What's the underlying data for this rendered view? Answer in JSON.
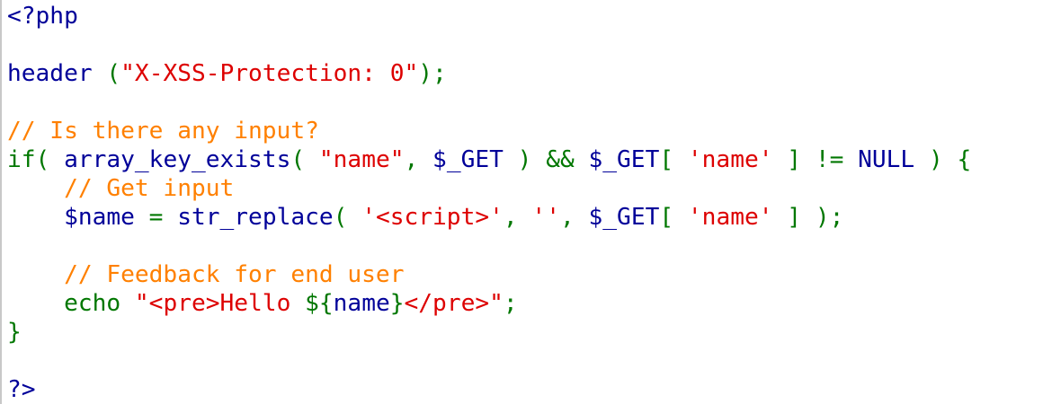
{
  "lines": [
    [
      {
        "text": "<?php",
        "c": "c-blue"
      }
    ],
    [],
    [
      {
        "text": "header ",
        "c": "c-blue"
      },
      {
        "text": "(",
        "c": "c-green"
      },
      {
        "text": "\"X-XSS-Protection: 0\"",
        "c": "c-red"
      },
      {
        "text": ");",
        "c": "c-green"
      }
    ],
    [],
    [
      {
        "text": "// Is there any input?",
        "c": "c-orange"
      }
    ],
    [
      {
        "text": "if( ",
        "c": "c-green"
      },
      {
        "text": "array_key_exists",
        "c": "c-blue"
      },
      {
        "text": "( ",
        "c": "c-green"
      },
      {
        "text": "\"name\"",
        "c": "c-red"
      },
      {
        "text": ", ",
        "c": "c-green"
      },
      {
        "text": "$_GET ",
        "c": "c-blue"
      },
      {
        "text": ") && ",
        "c": "c-green"
      },
      {
        "text": "$_GET",
        "c": "c-blue"
      },
      {
        "text": "[ ",
        "c": "c-green"
      },
      {
        "text": "'name' ",
        "c": "c-red"
      },
      {
        "text": "] != ",
        "c": "c-green"
      },
      {
        "text": "NULL ",
        "c": "c-blue"
      },
      {
        "text": ") {",
        "c": "c-green"
      }
    ],
    [
      {
        "text": "    // Get input",
        "c": "c-orange"
      }
    ],
    [
      {
        "text": "    $name ",
        "c": "c-blue"
      },
      {
        "text": "= ",
        "c": "c-green"
      },
      {
        "text": "str_replace",
        "c": "c-blue"
      },
      {
        "text": "( ",
        "c": "c-green"
      },
      {
        "text": "'<script>'",
        "c": "c-red"
      },
      {
        "text": ", ",
        "c": "c-green"
      },
      {
        "text": "''",
        "c": "c-red"
      },
      {
        "text": ", ",
        "c": "c-green"
      },
      {
        "text": "$_GET",
        "c": "c-blue"
      },
      {
        "text": "[ ",
        "c": "c-green"
      },
      {
        "text": "'name' ",
        "c": "c-red"
      },
      {
        "text": "] );",
        "c": "c-green"
      }
    ],
    [],
    [
      {
        "text": "    // Feedback for end user",
        "c": "c-orange"
      }
    ],
    [
      {
        "text": "    echo ",
        "c": "c-green"
      },
      {
        "text": "\"<pre>Hello ",
        "c": "c-red"
      },
      {
        "text": "${",
        "c": "c-green"
      },
      {
        "text": "name",
        "c": "c-blue"
      },
      {
        "text": "}",
        "c": "c-green"
      },
      {
        "text": "</pre>\"",
        "c": "c-red"
      },
      {
        "text": ";",
        "c": "c-green"
      }
    ],
    [
      {
        "text": "}",
        "c": "c-green"
      }
    ],
    [],
    [
      {
        "text": "?>",
        "c": "c-blue"
      }
    ]
  ]
}
